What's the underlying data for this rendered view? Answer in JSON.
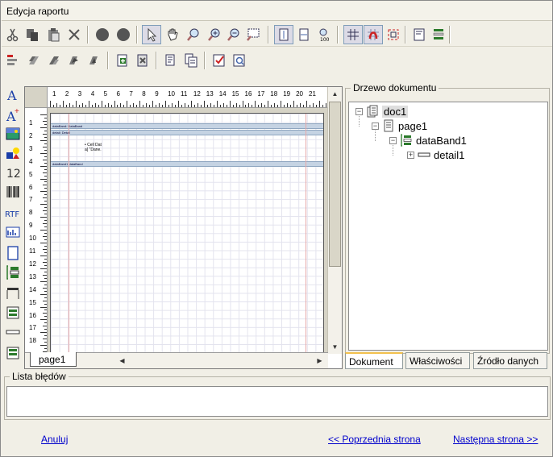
{
  "window": {
    "title": "Edycja raportu"
  },
  "toolbar1": [
    "cut-icon",
    "copy-icon",
    "paste-icon",
    "delete-icon",
    "circle-icon",
    "circle-icon",
    "pointer-icon",
    "hand-icon",
    "zoom-select-icon",
    "zoom-in-icon",
    "zoom-out-icon",
    "zoom-region-icon",
    "fit-height-icon",
    "fit-width-icon",
    "zoom-100-icon",
    "grid-icon",
    "snap-icon",
    "frame-icon",
    "page-setup-icon",
    "bands-icon"
  ],
  "toolbar2": [
    "align-icon",
    "bring-front-icon",
    "send-back-icon",
    "forward-icon",
    "backward-icon",
    "group-icon",
    "ungroup-icon",
    "copy-format-icon",
    "paste-format-icon",
    "check-icon",
    "preview-icon"
  ],
  "left_tools": [
    "text-icon",
    "text-plus-icon",
    "image-icon",
    "shapes-icon",
    "number-icon",
    "barcode-icon",
    "rtf-icon",
    "chart-icon",
    "page-icon",
    "databand-icon",
    "header-band-icon",
    "detail-band-icon",
    "line-icon",
    "footer-band-icon"
  ],
  "ruler": {
    "h_numbers": [
      "1",
      "2",
      "3",
      "4",
      "5",
      "6",
      "7",
      "8",
      "9",
      "10",
      "11",
      "12",
      "13",
      "14",
      "15",
      "16",
      "17",
      "18",
      "19",
      "20",
      "21"
    ],
    "v_numbers": [
      "1",
      "2",
      "3",
      "4",
      "5",
      "6",
      "7",
      "8",
      "9",
      "10",
      "11",
      "12",
      "13",
      "14",
      "15",
      "16",
      "17",
      "18"
    ]
  },
  "designer": {
    "bands": [
      "dataBand: DataBand",
      "detail: Detail",
      "dataBand1 dataBand"
    ],
    "field_1": "• Cell Dat",
    "field_2": "a] \"Dane.",
    "page_tab": "page1"
  },
  "tree": {
    "group_label": "Drzewo dokumentu",
    "nodes": [
      {
        "label": "doc1",
        "icon": "document-icon"
      },
      {
        "label": "page1",
        "icon": "page-icon"
      },
      {
        "label": "dataBand1",
        "icon": "databand-icon"
      },
      {
        "label": "detail1",
        "icon": "line-icon"
      }
    ]
  },
  "tabs": [
    "Dokument",
    "Właściwości",
    "Źródło danych"
  ],
  "errors": {
    "label": "Lista błędów"
  },
  "nav": {
    "cancel": "Anuluj",
    "prev": "<< Poprzednia strona",
    "next": "Następna strona >>"
  }
}
